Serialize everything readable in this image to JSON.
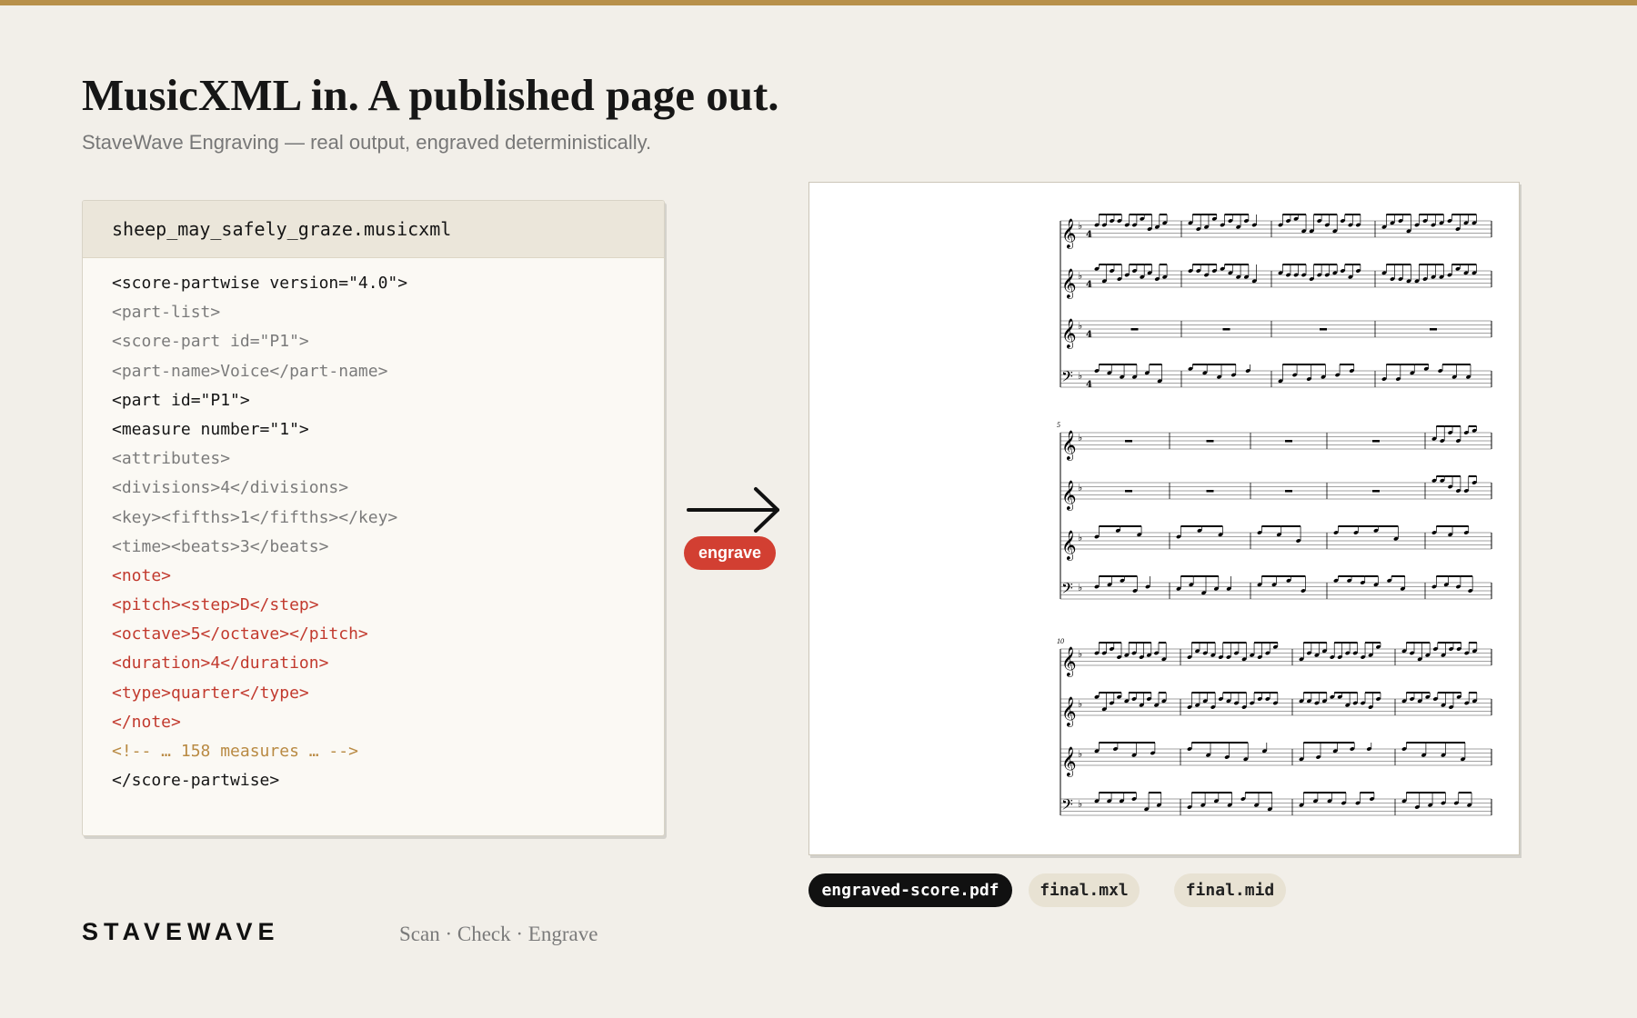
{
  "headline": "MusicXML in. A published page out.",
  "subhead": "StaveWave Engraving — real output, engraved deterministically.",
  "code_card": {
    "filename": "sheep_may_safely_graze.musicxml",
    "lines": [
      {
        "text": "<score-partwise version=\"4.0\">",
        "color": "black"
      },
      {
        "text": "<part-list>",
        "color": "gray"
      },
      {
        "text": "<score-part id=\"P1\">",
        "color": "gray"
      },
      {
        "text": "<part-name>Voice</part-name>",
        "color": "gray"
      },
      {
        "text": "<part id=\"P1\">",
        "color": "black"
      },
      {
        "text": "<measure number=\"1\">",
        "color": "black"
      },
      {
        "text": "<attributes>",
        "color": "gray"
      },
      {
        "text": "<divisions>4</divisions>",
        "color": "gray"
      },
      {
        "text": "<key><fifths>1</fifths></key>",
        "color": "gray"
      },
      {
        "text": "<time><beats>3</beats>",
        "color": "gray"
      },
      {
        "text": "<note>",
        "color": "red"
      },
      {
        "text": "<pitch><step>D</step>",
        "color": "red"
      },
      {
        "text": "<octave>5</octave></pitch>",
        "color": "red"
      },
      {
        "text": "<duration>4</duration>",
        "color": "red"
      },
      {
        "text": "<type>quarter</type>",
        "color": "red"
      },
      {
        "text": "</note>",
        "color": "red"
      },
      {
        "text": "<!-- … 158 measures … -->",
        "color": "gold"
      },
      {
        "text": "</score-partwise>",
        "color": "black"
      }
    ]
  },
  "arrow_icon": "arrow-right-icon",
  "engrave_label": "engrave",
  "score": {
    "system_measure_numbers": [
      "",
      "5",
      "10"
    ]
  },
  "files": {
    "pdf": "engraved-score.pdf",
    "mxl": "final.mxl",
    "mid": "final.mid"
  },
  "brand": "STAVEWAVE",
  "tagline": "Scan · Check · Engrave",
  "colors": {
    "accent_bar": "#b8904a",
    "background": "#f2efe9",
    "badge_red": "#d23f32",
    "code_red": "#c23a2e",
    "code_gold": "#b98a43",
    "code_gray": "#7b7b7b"
  }
}
